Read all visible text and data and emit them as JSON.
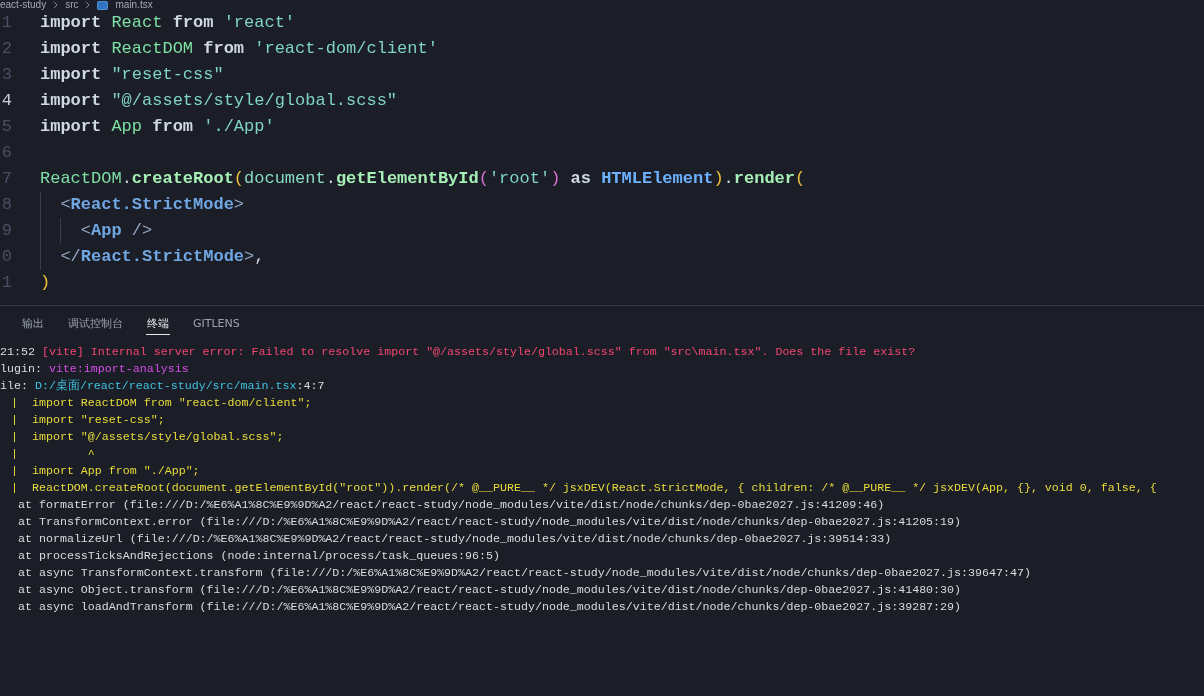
{
  "breadcrumb": [
    {
      "label": "eact-study",
      "kind": "folder"
    },
    {
      "label": "src",
      "kind": "folder"
    },
    {
      "label": "main.tsx",
      "kind": "file"
    }
  ],
  "editor": {
    "lines": [
      {
        "number": "1",
        "current": false,
        "tokens": [
          {
            "text": "import ",
            "kind": "keyword"
          },
          {
            "text": "React ",
            "kind": "identifier"
          },
          {
            "text": "from ",
            "kind": "keyword"
          },
          {
            "text": "'react'",
            "kind": "string"
          }
        ]
      },
      {
        "number": "2",
        "current": false,
        "tokens": [
          {
            "text": "import ",
            "kind": "keyword"
          },
          {
            "text": "ReactDOM ",
            "kind": "identifier"
          },
          {
            "text": "from ",
            "kind": "keyword"
          },
          {
            "text": "'react-dom/client'",
            "kind": "string"
          }
        ]
      },
      {
        "number": "3",
        "current": false,
        "tokens": [
          {
            "text": "import ",
            "kind": "keyword"
          },
          {
            "text": "\"reset-css\"",
            "kind": "string"
          }
        ]
      },
      {
        "number": "4",
        "current": true,
        "tokens": [
          {
            "text": "import ",
            "kind": "keyword"
          },
          {
            "text": "\"@/assets/style/global.scss\"",
            "kind": "string"
          }
        ]
      },
      {
        "number": "5",
        "current": false,
        "tokens": [
          {
            "text": "import ",
            "kind": "keyword"
          },
          {
            "text": "App ",
            "kind": "identifier"
          },
          {
            "text": "from ",
            "kind": "keyword"
          },
          {
            "text": "'./App'",
            "kind": "string"
          }
        ]
      },
      {
        "number": "6",
        "current": false
      },
      {
        "number": "7",
        "current": false,
        "tokens": [
          {
            "text": "ReactDOM",
            "kind": "identifier"
          },
          {
            "text": ".",
            "kind": "punct"
          },
          {
            "text": "createRoot",
            "kind": "function"
          },
          {
            "text": "(",
            "kind": "bracket"
          },
          {
            "text": "document",
            "kind": "variable"
          },
          {
            "text": ".",
            "kind": "punct"
          },
          {
            "text": "getElementById",
            "kind": "function"
          },
          {
            "text": "(",
            "kind": "bracket2"
          },
          {
            "text": "'root'",
            "kind": "string"
          },
          {
            "text": ")",
            "kind": "bracket2"
          },
          {
            "text": " as ",
            "kind": "keyword"
          },
          {
            "text": "HTMLElement",
            "kind": "type"
          },
          {
            "text": ")",
            "kind": "bracket"
          },
          {
            "text": ".",
            "kind": "punct"
          },
          {
            "text": "render",
            "kind": "function"
          },
          {
            "text": "(",
            "kind": "bracket"
          }
        ]
      },
      {
        "number": "8",
        "current": false,
        "tokens": [
          {
            "text": "  <",
            "kind": "tagpunct"
          },
          {
            "text": "React.StrictMode",
            "kind": "tag"
          },
          {
            "text": ">",
            "kind": "tagpunct"
          }
        ]
      },
      {
        "number": "9",
        "current": false,
        "tokens": [
          {
            "text": "    <",
            "kind": "tagpunct"
          },
          {
            "text": "App",
            "kind": "tag"
          },
          {
            "text": " />",
            "kind": "tagpunct"
          }
        ]
      },
      {
        "number": "0",
        "current": false,
        "tokens": [
          {
            "text": "  </",
            "kind": "tagpunct"
          },
          {
            "text": "React.StrictMode",
            "kind": "tag"
          },
          {
            "text": ">",
            "kind": "tagpunct"
          },
          {
            "text": ",",
            "kind": "punct"
          }
        ]
      },
      {
        "number": "1",
        "current": false,
        "tokens": [
          {
            "text": ")",
            "kind": "bracket"
          }
        ]
      }
    ]
  },
  "panel": {
    "tabs": [
      {
        "label": "输出",
        "selected": false
      },
      {
        "label": "调试控制台",
        "selected": false
      },
      {
        "label": "终端",
        "selected": true
      },
      {
        "label": "GITLENS",
        "selected": false
      }
    ],
    "terminal": [
      {
        "kind": "message",
        "segments": [
          {
            "text": "21:52 ",
            "kind": "plain"
          },
          {
            "text": "[vite] Internal server error: Failed to resolve import \"@/assets/style/global.scss\" from \"src\\main.tsx\". Does the file exist?",
            "kind": "error"
          }
        ]
      },
      {
        "kind": "message",
        "segments": [
          {
            "text": "lugin: ",
            "kind": "plain"
          },
          {
            "text": "vite:import-analysis",
            "kind": "plugin"
          }
        ]
      },
      {
        "kind": "message",
        "segments": [
          {
            "text": "ile: ",
            "kind": "plain"
          },
          {
            "text": "D:/桌面/react/react-study/src/main.tsx",
            "kind": "path"
          },
          {
            "text": ":4:7",
            "kind": "plain"
          }
        ]
      },
      {
        "kind": "frame",
        "segments": [
          {
            "text": "|  import ReactDOM from \"react-dom/client\";",
            "kind": "frame"
          }
        ]
      },
      {
        "kind": "frame",
        "segments": [
          {
            "text": "|  import \"reset-css\";",
            "kind": "frame"
          }
        ]
      },
      {
        "kind": "frame",
        "segments": [
          {
            "text": "|  import \"@/assets/style/global.scss\";",
            "kind": "frame"
          }
        ]
      },
      {
        "kind": "frame",
        "segments": [
          {
            "text": "|          ^",
            "kind": "frame"
          }
        ]
      },
      {
        "kind": "frame",
        "segments": [
          {
            "text": "|  import App from \"./App\";",
            "kind": "frame"
          }
        ]
      },
      {
        "kind": "frame",
        "segments": [
          {
            "text": "|  ReactDOM.createRoot(document.getElementById(\"root\")).render(/* @__PURE__ */ jsxDEV(React.StrictMode, { children: /* @__PURE__ */ jsxDEV(App, {}, void 0, false, {",
            "kind": "frame"
          }
        ]
      },
      {
        "kind": "stack",
        "segments": [
          {
            "text": "at formatError (file:///D:/%E6%A1%8C%E9%9D%A2/react/react-study/node_modules/vite/dist/node/chunks/dep-0bae2027.js:41209:46)",
            "kind": "plain"
          }
        ]
      },
      {
        "kind": "stack",
        "segments": [
          {
            "text": "at TransformContext.error (file:///D:/%E6%A1%8C%E9%9D%A2/react/react-study/node_modules/vite/dist/node/chunks/dep-0bae2027.js:41205:19)",
            "kind": "plain"
          }
        ]
      },
      {
        "kind": "stack",
        "segments": [
          {
            "text": "at normalizeUrl (file:///D:/%E6%A1%8C%E9%9D%A2/react/react-study/node_modules/vite/dist/node/chunks/dep-0bae2027.js:39514:33)",
            "kind": "plain"
          }
        ]
      },
      {
        "kind": "stack",
        "segments": [
          {
            "text": "at processTicksAndRejections (node:internal/process/task_queues:96:5)",
            "kind": "plain"
          }
        ]
      },
      {
        "kind": "stack",
        "segments": [
          {
            "text": "at async TransformContext.transform (file:///D:/%E6%A1%8C%E9%9D%A2/react/react-study/node_modules/vite/dist/node/chunks/dep-0bae2027.js:39647:47)",
            "kind": "plain"
          }
        ]
      },
      {
        "kind": "stack",
        "segments": [
          {
            "text": "at async Object.transform (file:///D:/%E6%A1%8C%E9%9D%A2/react/react-study/node_modules/vite/dist/node/chunks/dep-0bae2027.js:41480:30)",
            "kind": "plain"
          }
        ]
      },
      {
        "kind": "stack",
        "segments": [
          {
            "text": "at async loadAndTransform (file:///D:/%E6%A1%8C%E9%9D%A2/react/react-study/node_modules/vite/dist/node/chunks/dep-0bae2027.js:39287:29)",
            "kind": "plain"
          }
        ]
      }
    ]
  }
}
